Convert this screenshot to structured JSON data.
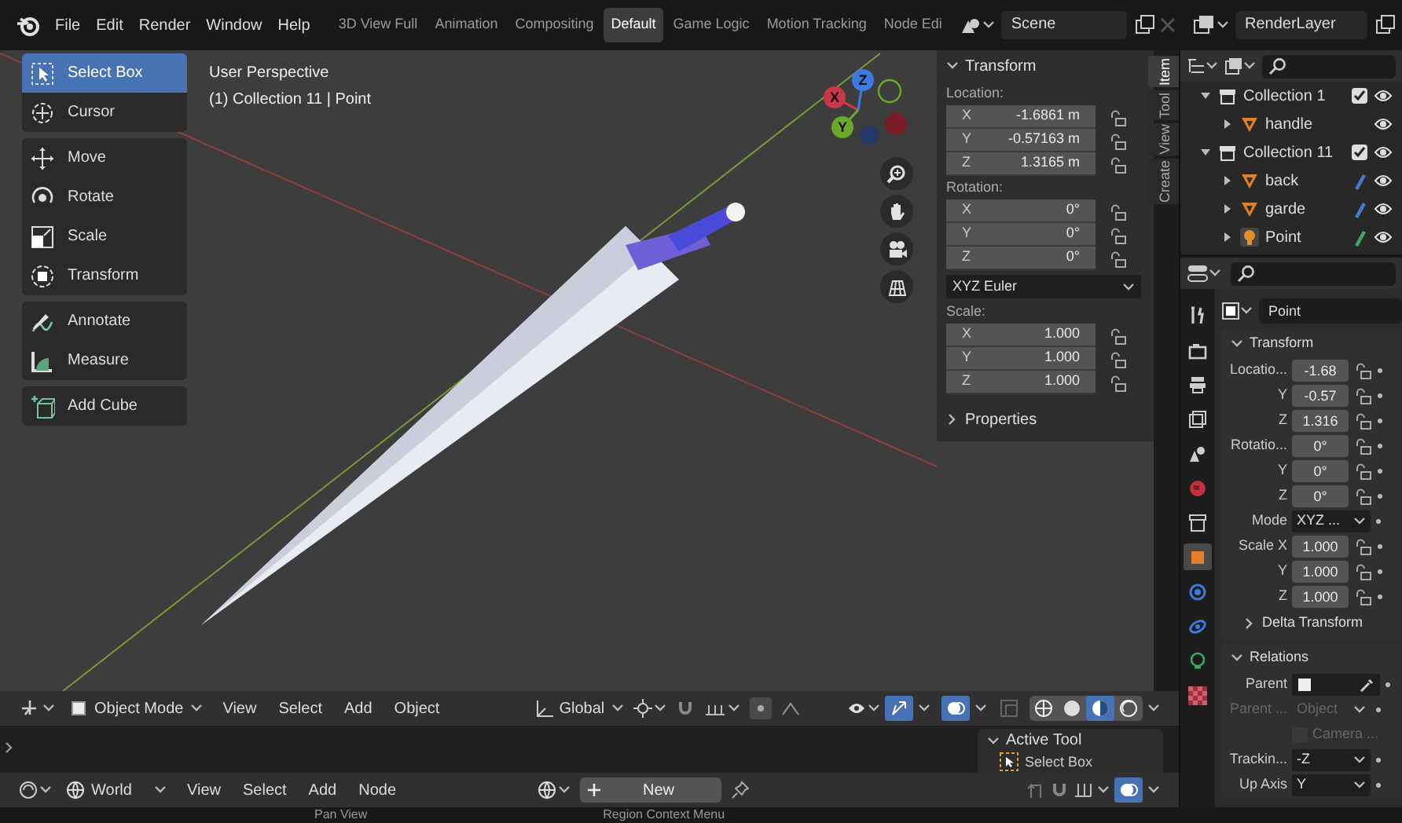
{
  "top_bar": {
    "menus": [
      "File",
      "Edit",
      "Render",
      "Window",
      "Help"
    ],
    "workspaces": [
      {
        "label": "3D View Full",
        "selected": false
      },
      {
        "label": "Animation",
        "selected": false
      },
      {
        "label": "Compositing",
        "selected": false
      },
      {
        "label": "Default",
        "selected": true
      },
      {
        "label": "Game Logic",
        "selected": false
      },
      {
        "label": "Motion Tracking",
        "selected": false
      },
      {
        "label": "Node Edi",
        "selected": false
      }
    ],
    "scene": "Scene",
    "view_layer": "RenderLayer"
  },
  "viewport": {
    "view_name": "User Perspective",
    "context": "(1) Collection 11 | Point",
    "toolbar": [
      [
        {
          "label": "Select Box",
          "selected": true,
          "kind": "select"
        },
        {
          "label": "Cursor",
          "selected": false,
          "kind": "cursor"
        }
      ],
      [
        {
          "label": "Move",
          "selected": false,
          "kind": "move"
        },
        {
          "label": "Rotate",
          "selected": false,
          "kind": "rotate"
        },
        {
          "label": "Scale",
          "selected": false,
          "kind": "scale"
        },
        {
          "label": "Transform",
          "selected": false,
          "kind": "transform"
        }
      ],
      [
        {
          "label": "Annotate",
          "selected": false,
          "kind": "annotate"
        },
        {
          "label": "Measure",
          "selected": false,
          "kind": "measure"
        }
      ],
      [
        {
          "label": "Add Cube",
          "selected": false,
          "kind": "cube"
        }
      ]
    ],
    "gizmo_axes": [
      "X",
      "Y",
      "Z"
    ]
  },
  "sidebar": {
    "tabs": [
      {
        "label": "Item",
        "selected": true
      },
      {
        "label": "Tool",
        "selected": false
      },
      {
        "label": "View",
        "selected": false
      },
      {
        "label": "Create",
        "selected": false
      }
    ],
    "panels": [
      {
        "title": "Transform",
        "expanded": true,
        "items": [
          {
            "kind": "vector",
            "label": "Location:",
            "rows": [
              {
                "axis": "X",
                "value": "-1.6861 m"
              },
              {
                "axis": "Y",
                "value": "-0.57163 m"
              },
              {
                "axis": "Z",
                "value": "1.3165 m"
              }
            ]
          },
          {
            "kind": "vector",
            "label": "Rotation:",
            "rows": [
              {
                "axis": "X",
                "value": "0°"
              },
              {
                "axis": "Y",
                "value": "0°"
              },
              {
                "axis": "Z",
                "value": "0°"
              }
            ]
          },
          {
            "kind": "dropdown",
            "value": "XYZ Euler"
          },
          {
            "kind": "vector",
            "label": "Scale:",
            "rows": [
              {
                "axis": "X",
                "value": "1.000"
              },
              {
                "axis": "Y",
                "value": "1.000"
              },
              {
                "axis": "Z",
                "value": "1.000"
              }
            ]
          }
        ]
      },
      {
        "title": "Properties",
        "expanded": false
      }
    ]
  },
  "viewport_header": {
    "mode": "Object Mode",
    "menus": [
      "View",
      "Select",
      "Add",
      "Object"
    ],
    "orientation": "Global",
    "gizmos_on": true,
    "overlays_on": true,
    "shading_modes": [
      {
        "kind": "wireframe",
        "selected": false
      },
      {
        "kind": "solid",
        "selected": false
      },
      {
        "kind": "material",
        "selected": true
      },
      {
        "kind": "rendered",
        "selected": false
      }
    ]
  },
  "active_tool_panel": {
    "title": "Active Tool",
    "tool": "Select Box"
  },
  "shader_header": {
    "world": "World",
    "menus": [
      "View",
      "Select",
      "Add",
      "Node"
    ],
    "new_button": "New"
  },
  "outliner": {
    "items": [
      {
        "kind": "collection",
        "label": "Collection 1",
        "expanded": true,
        "checked": true,
        "children": [
          {
            "kind": "mesh",
            "label": "handle",
            "expanded": false
          }
        ]
      },
      {
        "kind": "collection",
        "label": "Collection 11",
        "expanded": true,
        "checked": true,
        "children": [
          {
            "kind": "mesh",
            "label": "back",
            "expanded": false,
            "color": "#4a78c8"
          },
          {
            "kind": "mesh",
            "label": "garde",
            "expanded": false,
            "color": "#4a78c8"
          },
          {
            "kind": "light",
            "label": "Point",
            "expanded": false,
            "color": "#3fa66a"
          }
        ]
      }
    ]
  },
  "properties": {
    "tabs": [
      {
        "kind": "tool",
        "selected": false
      },
      {
        "kind": "render",
        "selected": false
      },
      {
        "kind": "output",
        "selected": false
      },
      {
        "kind": "view_layer",
        "selected": false
      },
      {
        "kind": "scene",
        "selected": false
      },
      {
        "kind": "world",
        "selected": false
      },
      {
        "kind": "collection",
        "selected": false
      },
      {
        "kind": "object",
        "selected": true
      },
      {
        "kind": "physics",
        "selected": false
      },
      {
        "kind": "constraints",
        "selected": false
      },
      {
        "kind": "light",
        "selected": false
      },
      {
        "kind": "texture",
        "selected": false
      }
    ],
    "object_name": "Point",
    "transform": {
      "title": "Transform",
      "expanded": true,
      "rows": [
        {
          "kind": "number",
          "label": "Locatio...",
          "value": "-1.68"
        },
        {
          "kind": "number",
          "label": "Y",
          "value": "-0.57"
        },
        {
          "kind": "number",
          "label": "Z",
          "value": "1.316"
        },
        {
          "kind": "number",
          "label": "Rotatio...",
          "value": "0°"
        },
        {
          "kind": "number",
          "label": "Y",
          "value": "0°"
        },
        {
          "kind": "number",
          "label": "Z",
          "value": "0°"
        },
        {
          "kind": "dropdown",
          "label": "Mode",
          "value": "XYZ ..."
        },
        {
          "kind": "number",
          "label": "Scale X",
          "value": "1.000"
        },
        {
          "kind": "number",
          "label": "Y",
          "value": "1.000"
        },
        {
          "kind": "number",
          "label": "Z",
          "value": "1.000"
        }
      ]
    },
    "delta_transform": {
      "title": "Delta Transform",
      "expanded": false
    },
    "relations": {
      "title": "Relations",
      "expanded": true,
      "rows": [
        {
          "kind": "object_field",
          "label": "Parent",
          "disabled": false
        },
        {
          "kind": "dropdown",
          "label": "Parent ...",
          "value": "Object",
          "disabled": true
        },
        {
          "kind": "checkbox",
          "label": "Camera ...",
          "checked": false,
          "disabled": true
        },
        {
          "kind": "dropdown",
          "label": "Trackin...",
          "value": "-Z",
          "disabled": false
        },
        {
          "kind": "dropdown",
          "label": "Up Axis",
          "value": "Y",
          "disabled": false
        }
      ]
    }
  },
  "status_bar": [
    "Pan View",
    "Region Context Menu"
  ]
}
